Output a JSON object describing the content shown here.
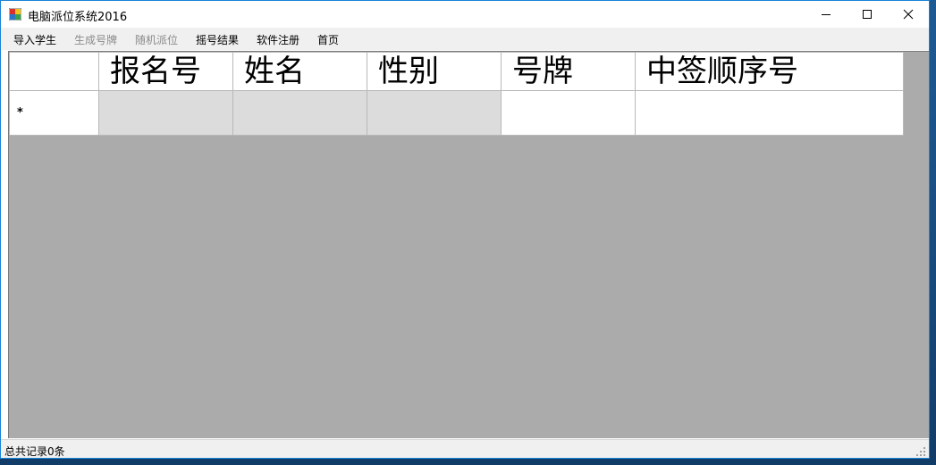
{
  "window": {
    "title": "电脑派位系统2016",
    "icon": "app-icon"
  },
  "menu": {
    "items": [
      {
        "label": "导入学生",
        "enabled": true
      },
      {
        "label": "生成号牌",
        "enabled": false
      },
      {
        "label": "随机派位",
        "enabled": false
      },
      {
        "label": "摇号结果",
        "enabled": true
      },
      {
        "label": "软件注册",
        "enabled": true
      },
      {
        "label": "首页",
        "enabled": true
      }
    ]
  },
  "grid": {
    "columns": [
      "报名号",
      "姓名",
      "性别",
      "号牌",
      "中签顺序号"
    ],
    "new_row_marker": "*"
  },
  "status": {
    "text": "总共记录0条"
  },
  "colors": {
    "grid_background": "#ababab",
    "readonly_cell": "#dcdcdc",
    "window_border": "#1883d7"
  }
}
